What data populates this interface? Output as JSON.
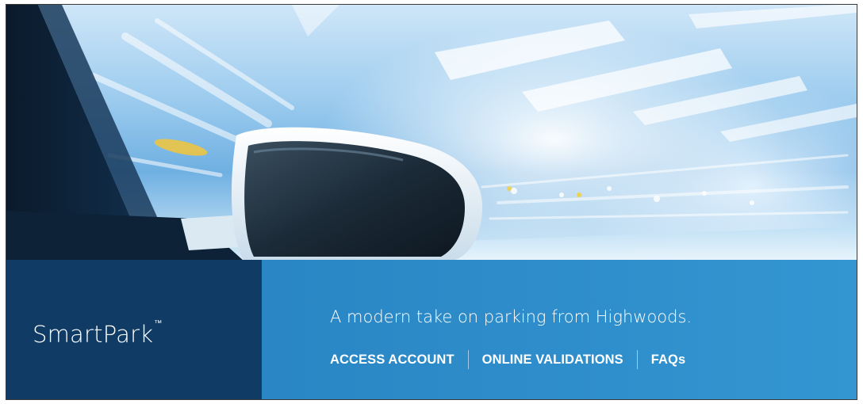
{
  "brand": {
    "name": "SmartPark",
    "trademark": "™"
  },
  "tagline": "A modern take on parking from Highwoods.",
  "nav": {
    "links": [
      {
        "label": "ACCESS ACCOUNT"
      },
      {
        "label": "ONLINE VALIDATIONS"
      },
      {
        "label": "FAQs"
      }
    ]
  },
  "colors": {
    "brand_panel": "#0f3b64",
    "info_panel": "#2f8fcc",
    "text": "#ffffff"
  }
}
